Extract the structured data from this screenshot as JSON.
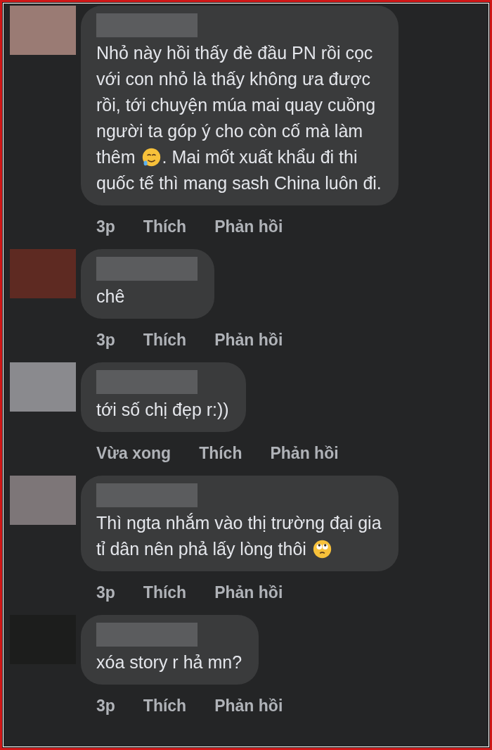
{
  "comments": [
    {
      "lines": [
        [
          {
            "kind": "text",
            "text": "Nhỏ này hồi thấy đè đầu PN rồi cọc"
          }
        ],
        [
          {
            "kind": "text",
            "text": "với con nhỏ là thấy không ưa được"
          }
        ],
        [
          {
            "kind": "text",
            "text": "rồi,  tới chuyện múa mai quay cuồng"
          }
        ],
        [
          {
            "kind": "text",
            "text": "người ta góp ý cho còn cố mà làm"
          }
        ],
        [
          {
            "kind": "text",
            "text": "thêm"
          },
          {
            "kind": "tearsmile"
          },
          {
            "kind": "text",
            "text": ". Mai mốt xuất khẩu đi thi"
          }
        ],
        [
          {
            "kind": "text",
            "text": "quốc tế thì mang sash China luôn đi."
          }
        ]
      ],
      "time": "3p",
      "like": "Thích",
      "reply": "Phản hồi"
    },
    {
      "lines": [
        [
          {
            "kind": "text",
            "text": "chê"
          }
        ]
      ],
      "time": "3p",
      "like": "Thích",
      "reply": "Phản hồi"
    },
    {
      "lines": [
        [
          {
            "kind": "text",
            "text": "tới số chị đẹp r:))"
          }
        ]
      ],
      "time": "Vừa xong",
      "like": "Thích",
      "reply": "Phản hồi"
    },
    {
      "lines": [
        [
          {
            "kind": "text",
            "text": "Thì ngta nhắm vào thị trường đại gia"
          }
        ],
        [
          {
            "kind": "text",
            "text": "tỉ dân nên phả lấy lòng thôi"
          },
          {
            "kind": "eyeroll"
          }
        ]
      ],
      "time": "3p",
      "like": "Thích",
      "reply": "Phản hồi"
    },
    {
      "lines": [
        [
          {
            "kind": "text",
            "text": "xóa story r hả mn?"
          }
        ]
      ],
      "time": "3p",
      "like": "Thích",
      "reply": "Phản hồi"
    }
  ]
}
